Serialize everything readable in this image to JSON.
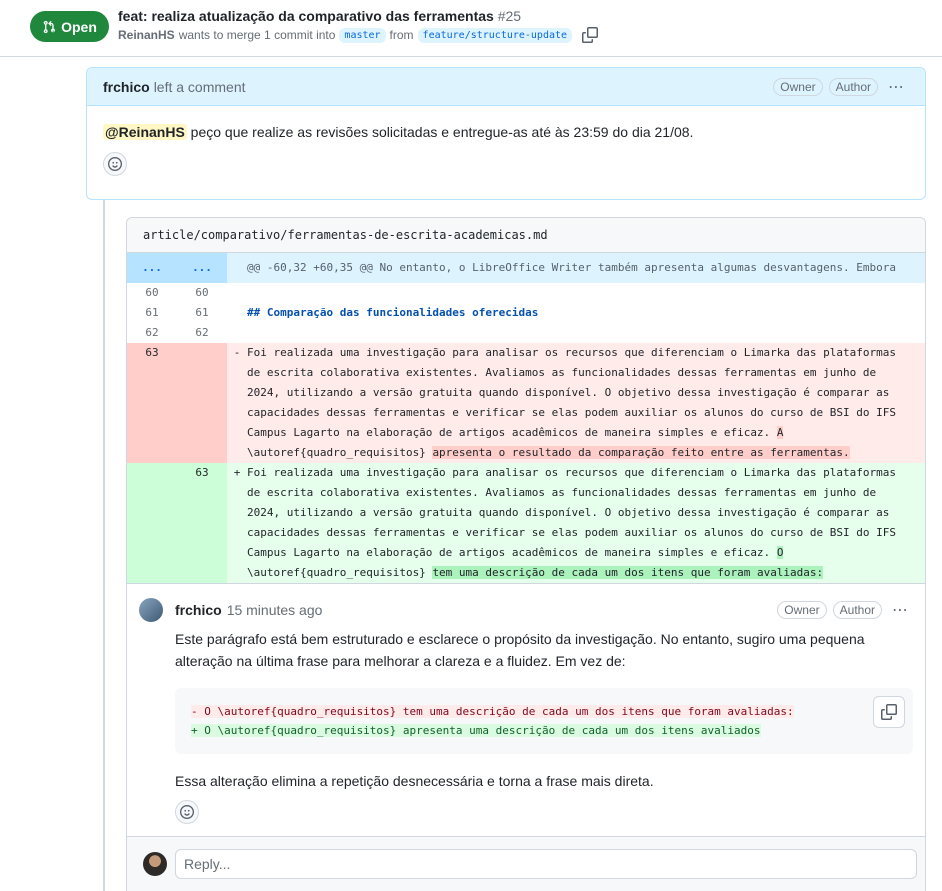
{
  "pr": {
    "state": "Open",
    "title": "feat: realiza atualização da comparativo das ferramentas",
    "number": "#25",
    "author": "ReinanHS",
    "merge_text": "wants to merge 1 commit into",
    "base_branch": "master",
    "from_text": "from",
    "head_branch": "feature/structure-update"
  },
  "comment1": {
    "author": "frchico",
    "action": "left a comment",
    "badge_owner": "Owner",
    "badge_author": "Author",
    "mention": "@ReinanHS",
    "body": " peço que realize as revisões solicitadas e entregue-as até às 23:59 do dia 21/08."
  },
  "diff": {
    "file": "article/comparativo/ferramentas-de-escrita-academicas.md",
    "hunk_old": "...",
    "hunk_new": "...",
    "hunk_header": "@@ -60,32 +60,35 @@ No entanto, o LibreOffice Writer também apresenta algumas desvantagens. Embora",
    "ctx": [
      {
        "old": "60",
        "new": "60",
        "code": ""
      },
      {
        "old": "61",
        "new": "61",
        "code": "## Comparação das funcionalidades oferecidas"
      },
      {
        "old": "62",
        "new": "62",
        "code": ""
      }
    ],
    "deleted": {
      "old": "63",
      "sign": "-",
      "code": "Foi realizada uma investigação para analisar os recursos que diferenciam o Limarka das plataformas de escrita colaborativa existentes. Avaliamos as funcionalidades dessas ferramentas em junho de 2024, utilizando a versão gratuita quando disponível. O objetivo dessa investigação é comparar as capacidades dessas ferramentas e verificar se elas podem auxiliar os alunos do curso de BSI do IFS Campus Lagarto na elaboração de artigos acadêmicos de maneira simples e eficaz. ",
      "hl1": "A",
      "mid": "\n\\autoref{quadro_requisitos} ",
      "hl2": "apresenta o resultado da comparação feito entre as ferramentas."
    },
    "added": {
      "new": "63",
      "sign": "+",
      "code": "Foi realizada uma investigação para analisar os recursos que diferenciam o Limarka das plataformas de escrita colaborativa existentes. Avaliamos as funcionalidades dessas ferramentas em junho de 2024, utilizando a versão gratuita quando disponível. O objetivo dessa investigação é comparar as capacidades dessas ferramentas e verificar se elas podem auxiliar os alunos do curso de BSI do IFS Campus Lagarto na elaboração de artigos acadêmicos de maneira simples e eficaz. ",
      "hl1": "O",
      "mid": "\n\\autoref{quadro_requisitos} ",
      "hl2": "tem uma descrição de cada um dos itens que foram avaliadas:"
    }
  },
  "review": {
    "author": "frchico",
    "time": "15 minutes ago",
    "badge_owner": "Owner",
    "badge_author": "Author",
    "body1": "Este parágrafo está bem estruturado e esclarece o propósito da investigação. No entanto, sugiro uma pequena alteração na última frase para melhorar a clareza e a fluidez. Em vez de:",
    "suggest_minus": "- O \\autoref{quadro_requisitos} tem uma descrição de cada um dos itens que foram avaliadas:",
    "suggest_plus": "+ O \\autoref{quadro_requisitos} apresenta uma descrição de cada um dos itens avaliados",
    "body2": "Essa alteração elimina a repetição desnecessária e torna a frase mais direta."
  },
  "reply": {
    "placeholder": "Reply..."
  },
  "icons": {
    "pr": "git-pull-request-icon",
    "copy": "copy-icon",
    "smiley": "smiley-icon",
    "kebab": "kebab-horizontal-icon"
  },
  "colors": {
    "open": "#1f883d",
    "link": "#0969da",
    "deleted_bg": "#ffebe9",
    "added_bg": "#e6ffec"
  }
}
